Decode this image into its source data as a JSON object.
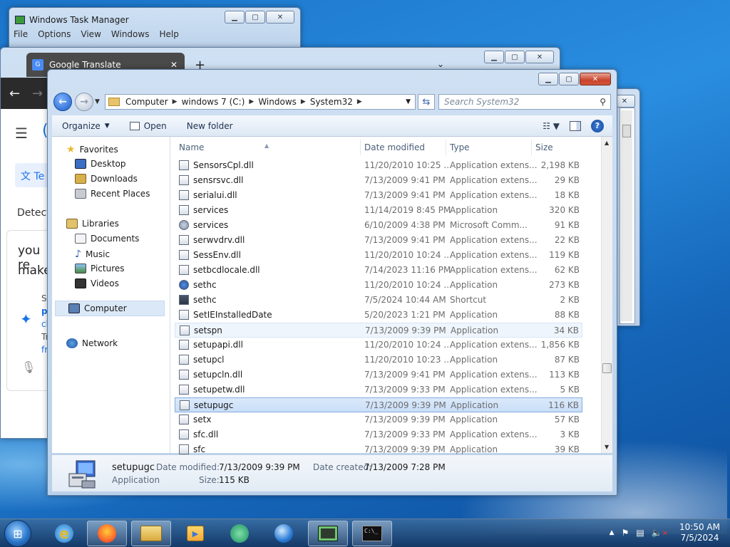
{
  "taskmgr": {
    "title": "Windows Task Manager",
    "menu": [
      "File",
      "Options",
      "View",
      "Windows",
      "Help"
    ]
  },
  "chrome": {
    "tab_title": "Google Translate",
    "page": {
      "source_chip": "Te",
      "detect_label": "Detect",
      "card_line1": "you re",
      "card_line2": "make",
      "card_fragments": [
        "S",
        "p",
        "cl",
        "Tr",
        "fr"
      ]
    }
  },
  "explorer": {
    "breadcrumb": [
      "Computer",
      "windows 7 (C:)",
      "Windows",
      "System32"
    ],
    "search_placeholder": "Search System32",
    "commands": {
      "organize": "Organize",
      "open": "Open",
      "new_folder": "New folder"
    },
    "nav": {
      "favorites": "Favorites",
      "desktop": "Desktop",
      "downloads": "Downloads",
      "recent": "Recent Places",
      "libraries": "Libraries",
      "documents": "Documents",
      "music": "Music",
      "pictures": "Pictures",
      "videos": "Videos",
      "computer": "Computer",
      "network": "Network"
    },
    "columns": {
      "name": "Name",
      "date": "Date modified",
      "type": "Type",
      "size": "Size"
    },
    "files": [
      {
        "name": "SensorsCpl.dll",
        "date": "11/20/2010 10:25 ...",
        "type": "Application extens...",
        "size": "2,198 KB",
        "icon": "dll"
      },
      {
        "name": "sensrsvc.dll",
        "date": "7/13/2009 9:41 PM",
        "type": "Application extens...",
        "size": "29 KB",
        "icon": "dll"
      },
      {
        "name": "serialui.dll",
        "date": "7/13/2009 9:41 PM",
        "type": "Application extens...",
        "size": "18 KB",
        "icon": "dll"
      },
      {
        "name": "services",
        "date": "11/14/2019 8:45 PM",
        "type": "Application",
        "size": "320 KB",
        "icon": "exe"
      },
      {
        "name": "services",
        "date": "6/10/2009 4:38 PM",
        "type": "Microsoft Comm...",
        "size": "91 KB",
        "icon": "gear"
      },
      {
        "name": "serwvdrv.dll",
        "date": "7/13/2009 9:41 PM",
        "type": "Application extens...",
        "size": "22 KB",
        "icon": "dll"
      },
      {
        "name": "SessEnv.dll",
        "date": "11/20/2010 10:24 ...",
        "type": "Application extens...",
        "size": "119 KB",
        "icon": "dll"
      },
      {
        "name": "setbcdlocale.dll",
        "date": "7/14/2023 11:16 PM",
        "type": "Application extens...",
        "size": "62 KB",
        "icon": "dll"
      },
      {
        "name": "sethc",
        "date": "11/20/2010 10:24 ...",
        "type": "Application",
        "size": "273 KB",
        "icon": "sethc"
      },
      {
        "name": "sethc",
        "date": "7/5/2024 10:44 AM",
        "type": "Shortcut",
        "size": "2 KB",
        "icon": "short"
      },
      {
        "name": "SetIEInstalledDate",
        "date": "5/20/2023 1:21 PM",
        "type": "Application",
        "size": "88 KB",
        "icon": "exe"
      },
      {
        "name": "setspn",
        "date": "7/13/2009 9:39 PM",
        "type": "Application",
        "size": "34 KB",
        "icon": "exe"
      },
      {
        "name": "setupapi.dll",
        "date": "11/20/2010 10:24 ...",
        "type": "Application extens...",
        "size": "1,856 KB",
        "icon": "dll"
      },
      {
        "name": "setupcl",
        "date": "11/20/2010 10:23 ...",
        "type": "Application",
        "size": "87 KB",
        "icon": "exe"
      },
      {
        "name": "setupcln.dll",
        "date": "7/13/2009 9:41 PM",
        "type": "Application extens...",
        "size": "113 KB",
        "icon": "dll"
      },
      {
        "name": "setupetw.dll",
        "date": "7/13/2009 9:33 PM",
        "type": "Application extens...",
        "size": "5 KB",
        "icon": "dll"
      },
      {
        "name": "setupugc",
        "date": "7/13/2009 9:39 PM",
        "type": "Application",
        "size": "116 KB",
        "icon": "exe"
      },
      {
        "name": "setx",
        "date": "7/13/2009 9:39 PM",
        "type": "Application",
        "size": "57 KB",
        "icon": "exe"
      },
      {
        "name": "sfc.dll",
        "date": "7/13/2009 9:33 PM",
        "type": "Application extens...",
        "size": "3 KB",
        "icon": "dll"
      },
      {
        "name": "sfc",
        "date": "7/13/2009 9:39 PM",
        "type": "Application",
        "size": "39 KB",
        "icon": "exe"
      }
    ],
    "hover_index": 11,
    "selected_index": 16,
    "details": {
      "name": "setupugc",
      "kind": "Application",
      "modified_label": "Date modified:",
      "modified_value": "7/13/2009 9:39 PM",
      "created_label": "Date created:",
      "created_value": "7/13/2009 7:28 PM",
      "size_label": "Size:",
      "size_value": "115 KB"
    }
  },
  "taskbar": {
    "time": "10:50 AM",
    "date": "7/5/2024"
  }
}
